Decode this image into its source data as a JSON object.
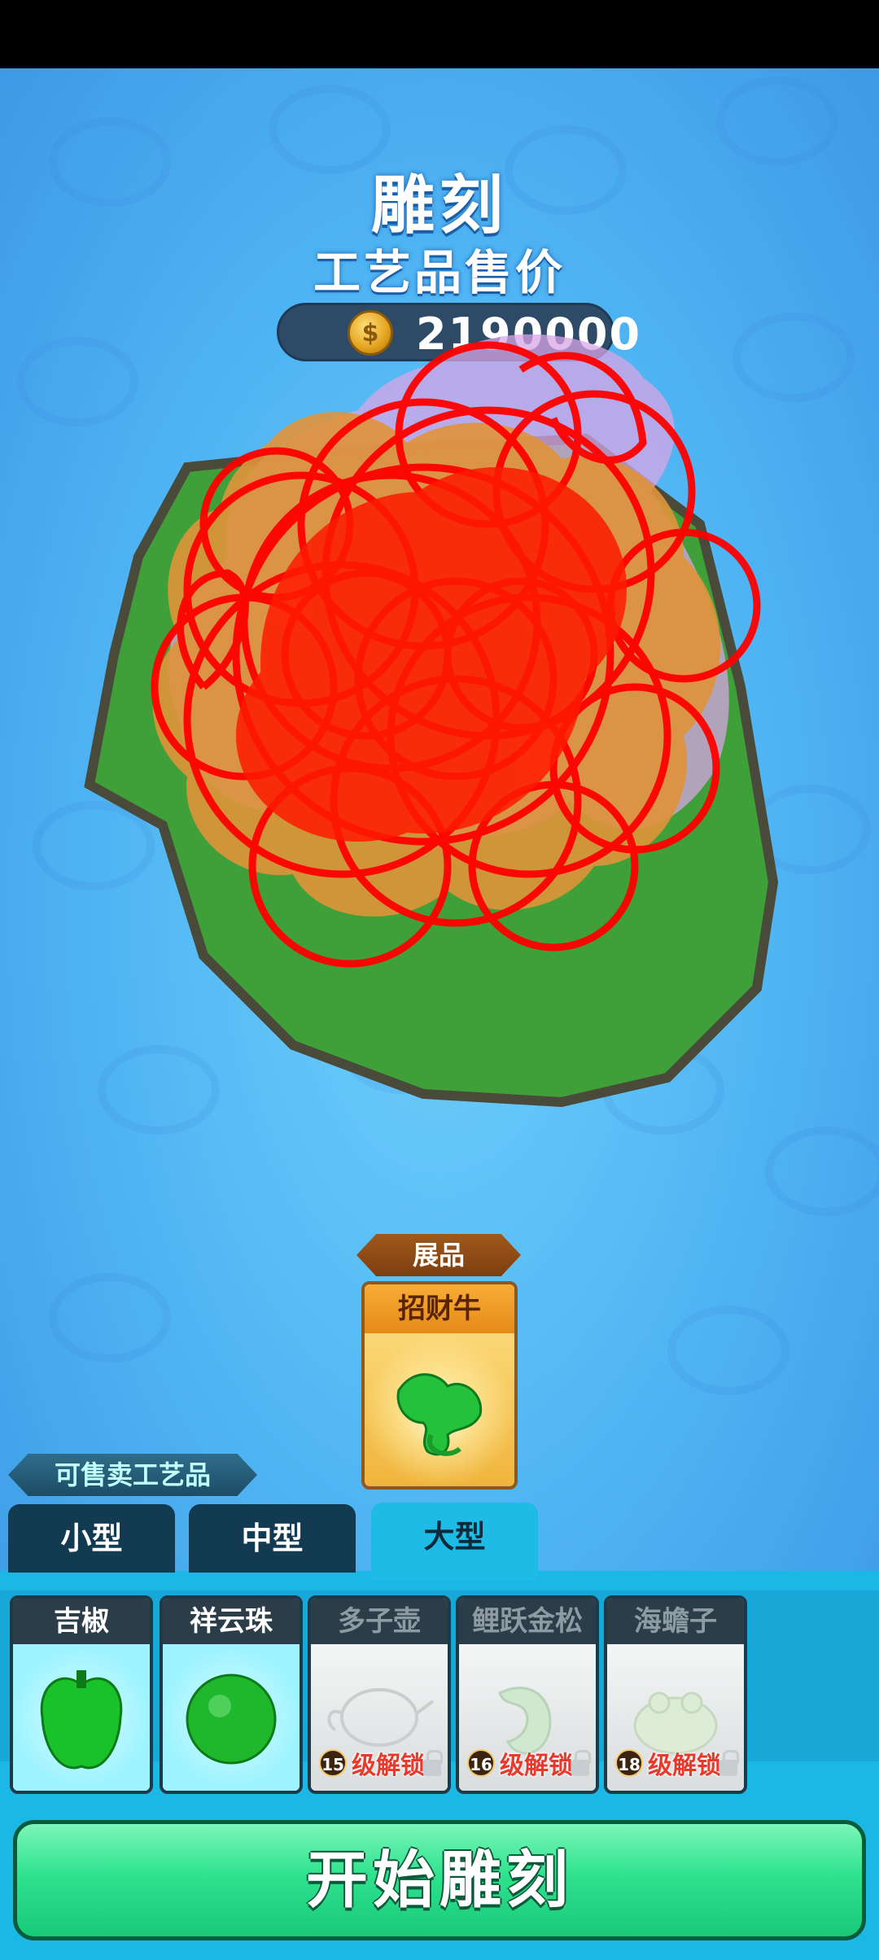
{
  "header": {
    "title": "雕刻",
    "subtitle": "工艺品售价",
    "price": "2190000",
    "coin_icon": "coin-icon"
  },
  "exhibit": {
    "label": "展品",
    "name": "招财牛",
    "icon": "jade-ox-icon"
  },
  "sell_section": {
    "label": "可售卖工艺品",
    "tabs": [
      {
        "label": "小型",
        "active": false
      },
      {
        "label": "中型",
        "active": false
      },
      {
        "label": "大型",
        "active": true
      }
    ],
    "items": [
      {
        "name": "吉椒",
        "locked": false,
        "icon": "jade-pepper-icon"
      },
      {
        "name": "祥云珠",
        "locked": false,
        "icon": "jade-ball-icon"
      },
      {
        "name": "多子壶",
        "locked": true,
        "level": "15",
        "unlock_text": "级解锁",
        "icon": "teapot-icon"
      },
      {
        "name": "鲤跃金松",
        "locked": true,
        "level": "16",
        "unlock_text": "级解锁",
        "icon": "carp-icon"
      },
      {
        "name": "海蟾子",
        "locked": true,
        "level": "18",
        "unlock_text": "级解锁",
        "icon": "toad-icon"
      }
    ]
  },
  "actions": {
    "start_label": "开始雕刻"
  },
  "colors": {
    "background": "#4fb4f3",
    "start_button": "#2fe28e",
    "tab_active": "#1ebbe6",
    "scribble": "#ff0000"
  }
}
